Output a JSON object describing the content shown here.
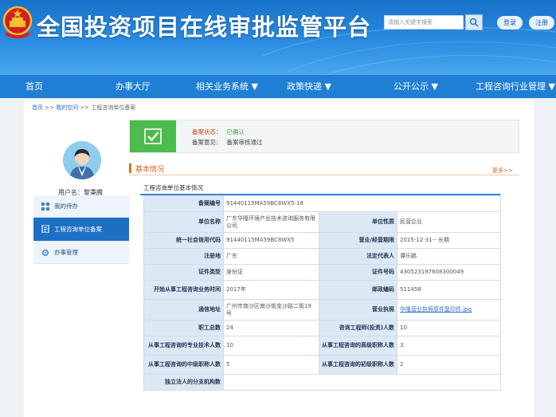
{
  "header": {
    "title": "全国投资项目在线审批监管平台",
    "search_placeholder": "请输入关键字搜索",
    "btn_login": "登录",
    "btn_register": "注册",
    "colors": {
      "banner": "#1872c9",
      "nav": "#1e7fd4",
      "accent": "#e46c1f"
    }
  },
  "nav": {
    "items": [
      "首页",
      "办事大厅",
      "相关业务系统 ▼",
      "政策快递 ▼",
      "公开公示 ▼",
      "工程咨询行业管理 ▼"
    ]
  },
  "breadcrumb": [
    "首页",
    "我的空间",
    "工程咨询单位备案"
  ],
  "sidebar": {
    "username_label": "用户名：",
    "username": "黎秉腾",
    "items": [
      {
        "label": "我的待办",
        "icon": "grid-icon"
      },
      {
        "label": "工程咨询单位备案",
        "icon": "document-icon"
      },
      {
        "label": "办事管理",
        "icon": "gear-icon"
      }
    ]
  },
  "status": {
    "state_label": "备案状态：",
    "state_value": "已确认",
    "opinion_label": "备案意见：",
    "opinion_value": "备案审核通过"
  },
  "section": {
    "title": "基本情况",
    "more": "更多>>",
    "tab": "工程咨询单位基本情况"
  },
  "table": {
    "rows": [
      {
        "l1": "备案编号",
        "v1": "91440115MA59BC8WX5-18"
      },
      {
        "l1": "单位名称",
        "v1": "广东华隆环境产业技术咨询服务有限公司",
        "l2": "单位性质",
        "v2": "民营企业"
      },
      {
        "l1": "统一社会信用代码",
        "v1": "91440115MA59BC8WX5",
        "l2": "营业/经营期限",
        "v2": "2015-12-31-- 长期"
      },
      {
        "l1": "注册地",
        "v1": "广东",
        "l2": "法定代表人",
        "v2": "谭乐鹏"
      },
      {
        "l1": "证件类型",
        "v1": "身份证",
        "l2": "证件号码",
        "v2": "430523197608300049"
      },
      {
        "l1": "开始从事工程咨询业务时间",
        "v1": "2017年",
        "l2": "邮政编码",
        "v2": "511458"
      },
      {
        "l1": "通信地址",
        "v1": "广州市南沙区南沙街金沙路二街19号",
        "l2": "营业执照",
        "v2": "华隆营业执照原件复印件.jpg"
      },
      {
        "l1": "职工总数",
        "v1": "24",
        "l2": "咨询工程师(投资)人数",
        "v2": "10"
      },
      {
        "l1": "从事工程咨询的专业技术人数",
        "v1": "10",
        "l2": "从事工程咨询的高级职称人数",
        "v2": "3"
      },
      {
        "l1": "从事工程咨询的中级职称人数",
        "v1": "5",
        "l2": "从事工程咨询的初级职称人数",
        "v2": "2"
      },
      {
        "l1": "独立法人的分支机构数",
        "v1": ""
      }
    ]
  }
}
